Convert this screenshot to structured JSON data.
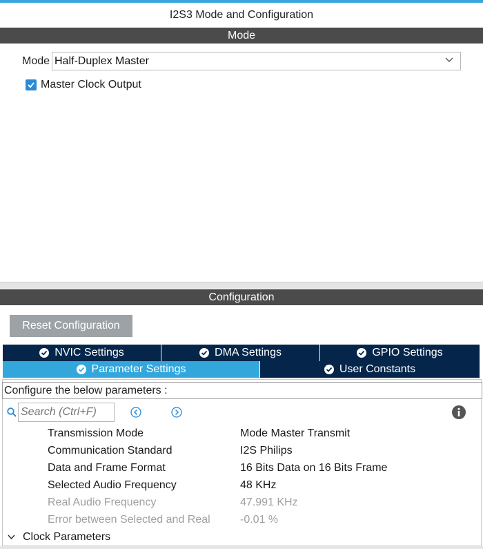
{
  "window": {
    "title": "I2S3 Mode and Configuration"
  },
  "mode_section": {
    "header": "Mode",
    "mode_label": "Mode",
    "mode_value": "Half-Duplex Master",
    "master_clock_output": {
      "label": "Master Clock Output",
      "checked": true
    }
  },
  "config_section": {
    "header": "Configuration",
    "reset_button": "Reset Configuration",
    "tabs_row1": [
      {
        "label": "NVIC Settings"
      },
      {
        "label": "DMA Settings"
      },
      {
        "label": "GPIO Settings"
      }
    ],
    "tabs_row2": [
      {
        "label": "Parameter Settings",
        "active": true
      },
      {
        "label": "User Constants"
      }
    ],
    "hint": "Configure the below parameters :",
    "search": {
      "placeholder": "Search (Ctrl+F)"
    },
    "parameters": [
      {
        "name": "Transmission Mode",
        "value": "Mode Master Transmit",
        "dim": false
      },
      {
        "name": "Communication Standard",
        "value": "I2S Philips",
        "dim": false
      },
      {
        "name": "Data and Frame Format",
        "value": "16 Bits Data on 16 Bits Frame",
        "dim": false
      },
      {
        "name": "Selected Audio Frequency",
        "value": "48 KHz",
        "dim": false
      },
      {
        "name": "Real Audio Frequency",
        "value": "47.991 KHz",
        "dim": true
      },
      {
        "name": "Error between Selected and Real",
        "value": "-0.01 %",
        "dim": true
      }
    ],
    "group": {
      "label": "Clock Parameters",
      "expanded": true
    }
  },
  "colors": {
    "accent": "#33a7dc",
    "tab_dark": "#05264a",
    "section_bar": "#4b4b4b",
    "button_gray": "#9da2a6",
    "checkbox": "#2b8ad6"
  }
}
